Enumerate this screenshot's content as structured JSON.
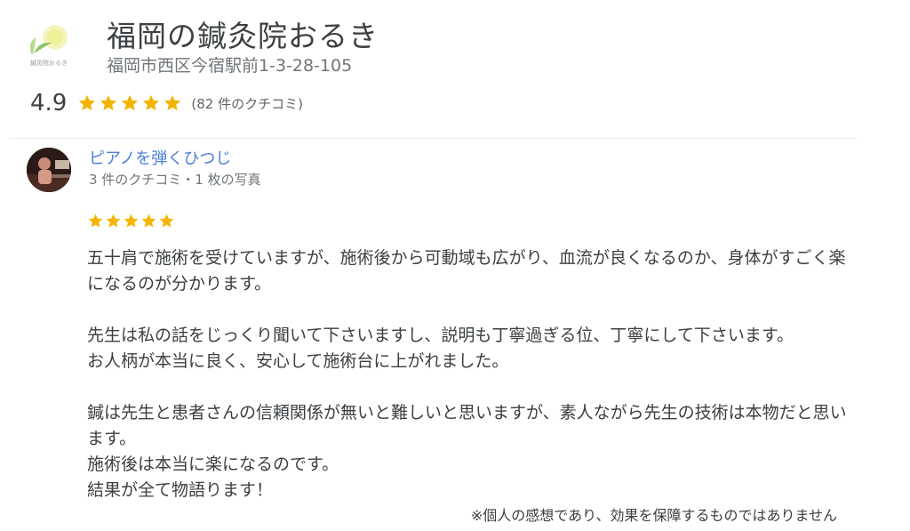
{
  "business": {
    "name": "福岡の鍼灸院おるき",
    "address": "福岡市西区今宿駅前1-3-28-105",
    "logo_text": "鍼灸院おるき",
    "rating": "4.9",
    "stars": 5,
    "review_count": "(82 件のクチコミ)"
  },
  "review": {
    "reviewer_name": "ピアノを弾くひつじ",
    "reviewer_meta": "3 件のクチコミ・1 枚の写真",
    "stars": 5,
    "paragraphs": [
      "五十肩で施術を受けていますが、施術後から可動域も広がり、血流が良くなるのか、身体がすごく楽になるのが分かります。",
      "先生は私の話をじっくり聞いて下さいますし、説明も丁寧過ぎる位、丁寧にして下さいます。",
      "お人柄が本当に良く、安心して施術台に上がれました。",
      "鍼は先生と患者さんの信頼関係が無いと難しいと思いますが、素人ながら先生の技術は本物だと思います。",
      "施術後は本当に楽になるのです。",
      "結果が全て物語ります！"
    ]
  },
  "disclaimer": "※個人の感想であり、効果を保障するものではありません",
  "colors": {
    "star": "#f4b400",
    "link": "#4a7fd6",
    "text": "#3c4043",
    "muted": "#70757a"
  }
}
